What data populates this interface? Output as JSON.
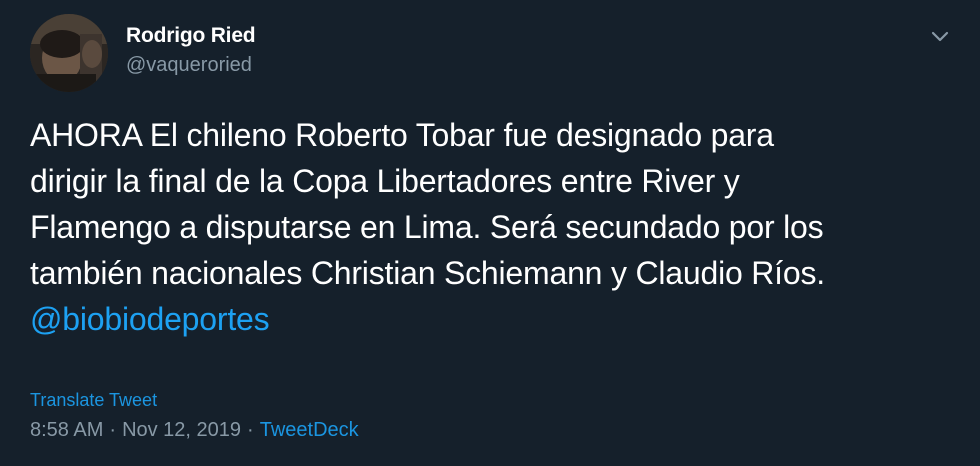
{
  "user": {
    "display_name": "Rodrigo Ried",
    "handle": "@vaqueroried"
  },
  "tweet": {
    "lines": [
      "AHORA El chileno Roberto Tobar fue designado para",
      "dirigir la final de la Copa Libertadores entre River y",
      "Flamengo a disputarse en Lima. Será secundado por los",
      "también nacionales Christian Schiemann y Claudio Ríos."
    ],
    "mention": "@biobiodeportes"
  },
  "translate_label": "Translate Tweet",
  "meta": {
    "time": "8:58 AM",
    "separator": "·",
    "date": "Nov 12, 2019",
    "source": "TweetDeck"
  },
  "colors": {
    "background": "#15202b",
    "link": "#1da1f2",
    "secondary_text": "#8899a6"
  },
  "icons": {
    "menu": "chevron-down-icon"
  }
}
